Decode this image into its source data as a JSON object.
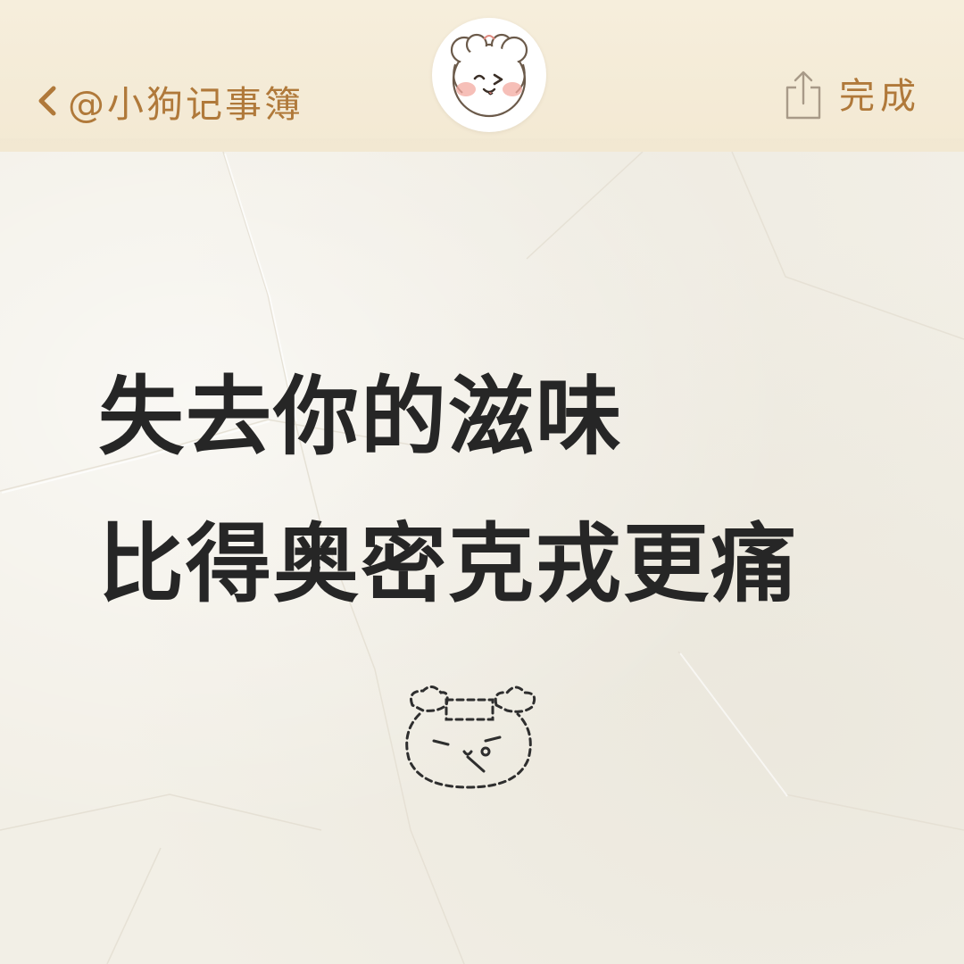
{
  "header": {
    "back_label": "@小狗记事簿",
    "done_label": "完成"
  },
  "icons": {
    "back": "chevron-left-icon",
    "share": "share-icon",
    "avatar": "puppy-avatar",
    "doodle": "sleepy-puppy-doodle"
  },
  "note": {
    "lines": [
      "失去你的滋味",
      "比得奥密克戎更痛"
    ]
  },
  "colors": {
    "accent": "#b0793a",
    "header_bg": "#f5ecd8",
    "paper_bg": "#f2efe6",
    "text": "#262626"
  }
}
